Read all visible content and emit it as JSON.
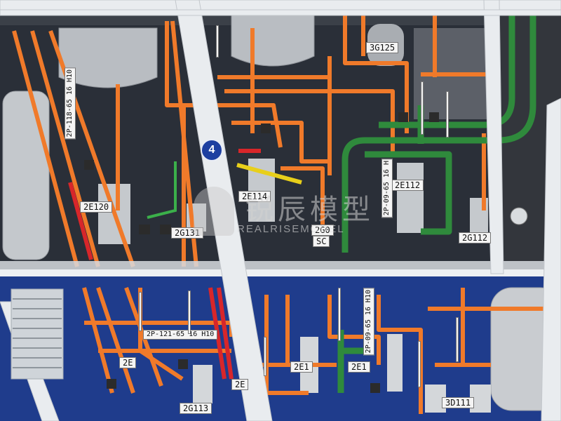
{
  "scene": {
    "floor_badge": "4",
    "watermark": {
      "chinese": "锐辰模型",
      "english": "REALRISEMODEL"
    },
    "equipment_labels": [
      "3G125",
      "2E120",
      "2E114",
      "2E112",
      "2G131",
      "2G112",
      "2G113",
      "2E1",
      "2E1",
      "2E",
      "3D111",
      "2G0",
      "SC",
      "2E"
    ],
    "pipe_tags": [
      "2P-118-65  16 H10",
      "2P-121-65  16 H10",
      "2P-09-65  16 H",
      "2P-09-65  16 H10"
    ]
  },
  "colors": {
    "pipe_orange": "#f07a2a",
    "pipe_green": "#2f8a3c",
    "pipe_red": "#d8262a",
    "pipe_yellow": "#e8cf1a",
    "structure_white": "#e9ecef",
    "floor_blue": "#1f3c8c",
    "badge_blue": "#1d3fa0"
  }
}
